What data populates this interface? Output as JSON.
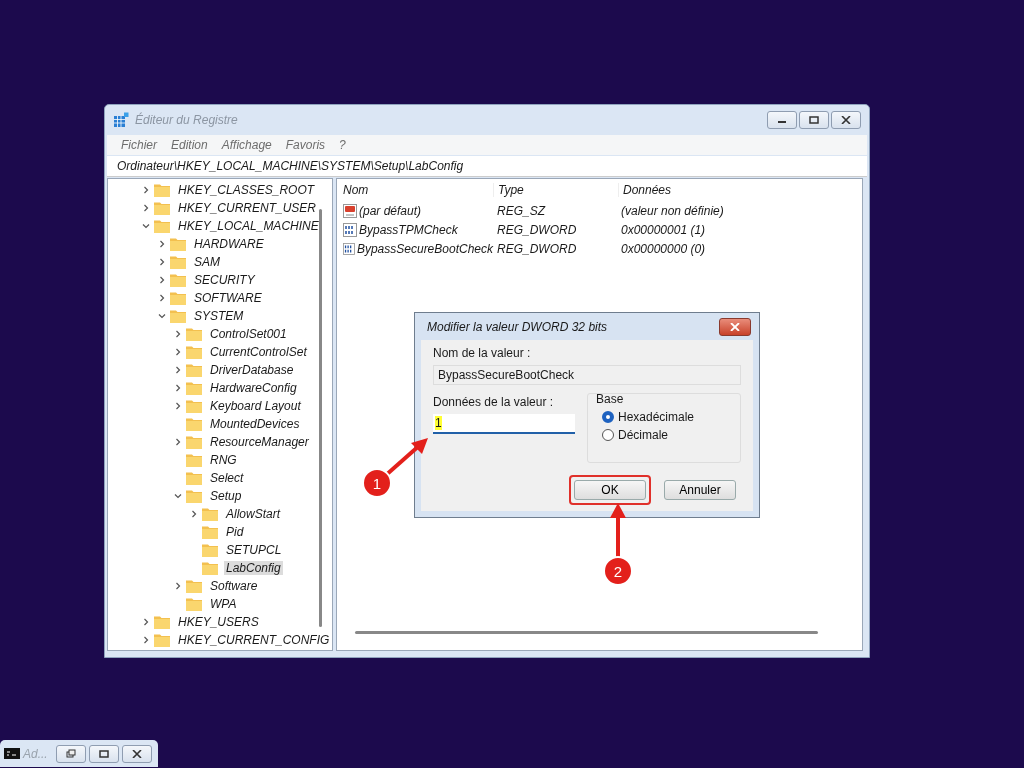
{
  "window": {
    "title": "Éditeur du Registre"
  },
  "menu": [
    "Fichier",
    "Edition",
    "Affichage",
    "Favoris",
    "?"
  ],
  "address": "Ordinateur\\HKEY_LOCAL_MACHINE\\SYSTEM\\Setup\\LabConfig",
  "tree": [
    {
      "label": "HKEY_CLASSES_ROOT",
      "kind": "branch",
      "expanded": false,
      "selected": false
    },
    {
      "label": "HKEY_CURRENT_USER",
      "kind": "branch",
      "expanded": false,
      "selected": false
    },
    {
      "label": "HKEY_LOCAL_MACHINE",
      "kind": "branch",
      "expanded": true,
      "selected": false,
      "children": [
        {
          "label": "HARDWARE",
          "kind": "branch",
          "expanded": false,
          "selected": false
        },
        {
          "label": "SAM",
          "kind": "branch",
          "expanded": false,
          "selected": false
        },
        {
          "label": "SECURITY",
          "kind": "branch",
          "expanded": false,
          "selected": false
        },
        {
          "label": "SOFTWARE",
          "kind": "branch",
          "expanded": false,
          "selected": false
        },
        {
          "label": "SYSTEM",
          "kind": "branch",
          "expanded": true,
          "selected": false,
          "children": [
            {
              "label": "ControlSet001",
              "kind": "branch",
              "expanded": false,
              "selected": false
            },
            {
              "label": "CurrentControlSet",
              "kind": "branch",
              "expanded": false,
              "selected": false
            },
            {
              "label": "DriverDatabase",
              "kind": "branch",
              "expanded": false,
              "selected": false
            },
            {
              "label": "HardwareConfig",
              "kind": "branch",
              "expanded": false,
              "selected": false
            },
            {
              "label": "Keyboard Layout",
              "kind": "branch",
              "expanded": false,
              "selected": false
            },
            {
              "label": "MountedDevices",
              "kind": "leaf",
              "selected": false
            },
            {
              "label": "ResourceManager",
              "kind": "branch",
              "expanded": false,
              "selected": false
            },
            {
              "label": "RNG",
              "kind": "leaf",
              "selected": false
            },
            {
              "label": "Select",
              "kind": "leaf",
              "selected": false
            },
            {
              "label": "Setup",
              "kind": "branch",
              "expanded": true,
              "selected": false,
              "children": [
                {
                  "label": "AllowStart",
                  "kind": "branch",
                  "expanded": false,
                  "selected": false
                },
                {
                  "label": "Pid",
                  "kind": "leaf",
                  "selected": false
                },
                {
                  "label": "SETUPCL",
                  "kind": "leaf",
                  "selected": false
                },
                {
                  "label": "LabConfig",
                  "kind": "leaf",
                  "selected": true
                }
              ]
            },
            {
              "label": "Software",
              "kind": "branch",
              "expanded": false,
              "selected": false
            },
            {
              "label": "WPA",
              "kind": "leaf",
              "selected": false
            }
          ]
        }
      ]
    },
    {
      "label": "HKEY_USERS",
      "kind": "branch",
      "expanded": false,
      "selected": false
    },
    {
      "label": "HKEY_CURRENT_CONFIG",
      "kind": "branch",
      "expanded": false,
      "selected": false
    }
  ],
  "values": {
    "columns": [
      "Nom",
      "Type",
      "Données"
    ],
    "rows": [
      {
        "kind": "string",
        "name": "(par défaut)",
        "type": "REG_SZ",
        "data": "(valeur non définie)"
      },
      {
        "kind": "dword",
        "name": "BypassTPMCheck",
        "type": "REG_DWORD",
        "data": "0x00000001 (1)"
      },
      {
        "kind": "dword",
        "name": "BypassSecureBootCheck",
        "type": "REG_DWORD",
        "data": "0x00000000 (0)"
      }
    ]
  },
  "dialog": {
    "title": "Modifier la valeur DWORD 32 bits",
    "name_label": "Nom de la valeur :",
    "name_value": "BypassSecureBootCheck",
    "data_label": "Données de la valeur :",
    "data_value": "1",
    "base": {
      "label": "Base",
      "options": [
        {
          "label": "Hexadécimale",
          "selected": true
        },
        {
          "label": "Décimale",
          "selected": false
        }
      ]
    },
    "buttons": [
      {
        "label": "OK",
        "highlighted": true
      },
      {
        "label": "Annuler",
        "highlighted": false
      }
    ]
  },
  "annotations": [
    {
      "number": "1"
    },
    {
      "number": "2"
    }
  ],
  "minimized_window": {
    "title": "Ad..."
  }
}
